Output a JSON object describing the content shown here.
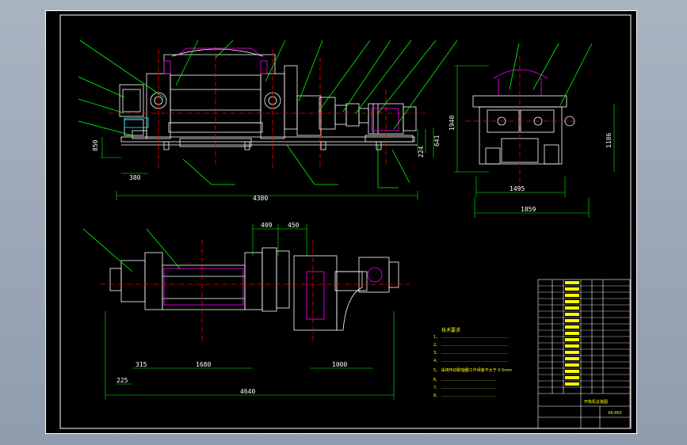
{
  "drawing": {
    "background": "#000000",
    "colors": {
      "frame": "#ffffff",
      "body": "#ffffff",
      "center": "#ff0000",
      "leader": "#00ff00",
      "text": "#ffff00",
      "hidden": "#00ffff",
      "accent": "#ff00ff"
    },
    "dimensions": {
      "front_total_length": "4380",
      "front_left_offset": "380",
      "front_height": "850",
      "front_right_1": "224",
      "front_right_2": "641",
      "side_height": "1940",
      "side_height_2": "1186",
      "side_width_1": "1495",
      "side_width_2": "1859",
      "plan_409": "409",
      "plan_450": "450",
      "plan_315": "315",
      "plan_1680": "1680",
      "plan_1000": "1000",
      "plan_225": "225",
      "plan_total": "4640"
    },
    "notes": {
      "title": "技术要求",
      "items": [
        "1、 ……………………………………………",
        "2、 ……………………………………………",
        "3、 ……………………………………………",
        "4、 ……………………………………………",
        "5、 采用传动联轴器工作误差不大于 0.5mm",
        "6、 ……………………………………",
        "7、 ……………………………………",
        "8、 ……………………………………"
      ]
    },
    "title_block": {
      "drawing_no": "XK-450",
      "name": "开炼机总装图"
    }
  }
}
